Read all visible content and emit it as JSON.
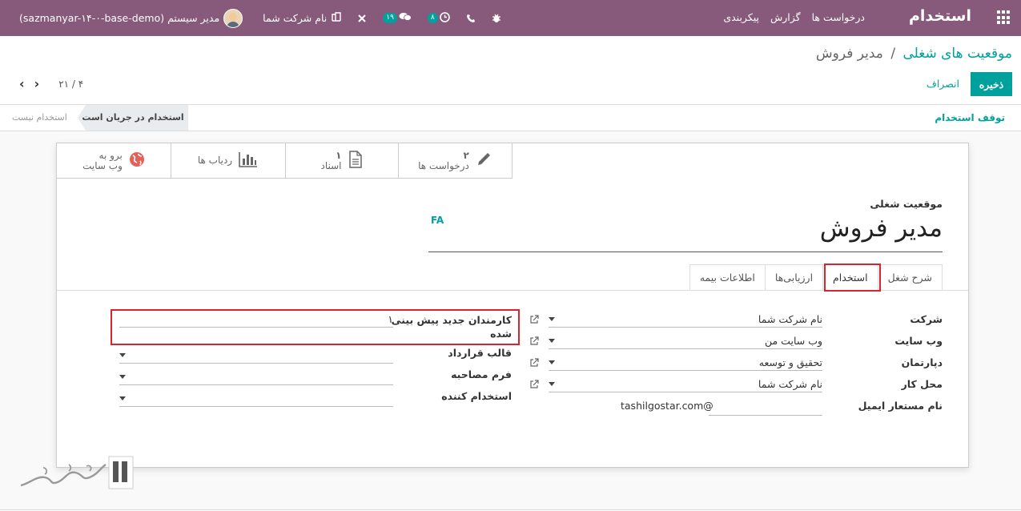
{
  "navbar": {
    "brand": "استخدام",
    "menu": [
      "درخواست ها",
      "گزارش",
      "پیکربندی"
    ],
    "company": "نام شرکت شما",
    "user": "مدیر سیستم (sazmanyar-۱۴-۰-base-demo)",
    "badge_messages": "۱۹",
    "badge_activities": "۸"
  },
  "breadcrumb": {
    "parent": "موقعیت های شغلی",
    "separator": "/",
    "current": "مدیر فروش"
  },
  "actions": {
    "save": "ذخیره",
    "cancel": "انصراف"
  },
  "pager": {
    "count": "۲۱ / ۴"
  },
  "status": {
    "stop": "توقف استخدام",
    "stage_active": "استخدام در جریان است",
    "stage_idle": "استخدام نیست"
  },
  "smart_buttons": {
    "requests": {
      "count": "۲",
      "label": "درخواست ها"
    },
    "documents": {
      "count": "۱",
      "label": "اسناد"
    },
    "trackers": {
      "label": "ردیاب ها"
    },
    "website": {
      "line1": "برو به",
      "line2": "وب سایت"
    }
  },
  "form": {
    "job_label": "موقعیت شغلی",
    "job_name": "مدیر فروش",
    "lang_tag": "FA"
  },
  "tabs": [
    "شرح شغل",
    "استخدام",
    "ارزیابی‌ها",
    "اطلاعات بیمه"
  ],
  "fields_right": [
    {
      "label": "شرکت",
      "value": "نام شرکت شما"
    },
    {
      "label": "وب سایت",
      "value": "وب سایت من"
    },
    {
      "label": "دپارتمان",
      "value": "تحقیق و توسعه"
    },
    {
      "label": "محل کار",
      "value": "نام شرکت شما"
    },
    {
      "label": "نام مستعار ایمیل",
      "value": "tashilgostar.com@"
    }
  ],
  "fields_left": [
    {
      "label": "کارمندان جدید پیش بینی",
      "label2": "شده",
      "value": "۱"
    },
    {
      "label": "قالب قرارداد",
      "value": ""
    },
    {
      "label": "فرم مصاحبه",
      "value": ""
    },
    {
      "label": "استخدام کننده",
      "value": ""
    }
  ],
  "colors": {
    "navbar": "#875a7b",
    "accent": "#00a09d",
    "highlight": "#d9232d"
  }
}
